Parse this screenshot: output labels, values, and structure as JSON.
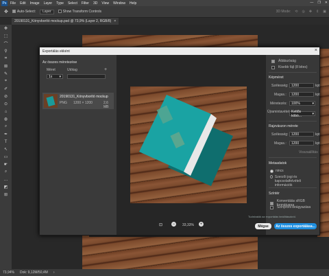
{
  "app": {
    "menu": [
      "File",
      "Edit",
      "Image",
      "Layer",
      "Type",
      "Select",
      "Filter",
      "3D",
      "View",
      "Window",
      "Help"
    ],
    "logo": "Ps",
    "window_controls": [
      "—",
      "❐",
      "✕"
    ]
  },
  "options_bar": {
    "auto_select_label": "Auto-Select:",
    "auto_select_value": "Layer",
    "transform_controls_label": "Show Transform Controls",
    "mode_3d": "3D Mode:"
  },
  "document": {
    "tab_title": "20190131_Könyvborító mockup.psd @ 73,9% (Layer 2, RGB/8)",
    "close": "×"
  },
  "tools": [
    "✥",
    "⬚",
    "⌒",
    "⚲",
    "⌗",
    "⊠",
    "✎",
    "⌖",
    "✐",
    "⊘",
    "⊙",
    "⌂",
    "◍",
    "⌕",
    "✒",
    "T",
    "↖",
    "▭",
    "☛",
    "⌕",
    "…",
    "◩",
    "⊞"
  ],
  "status": {
    "zoom": "73,94%",
    "doc_size": "Dok: 9,12M/50,4M"
  },
  "dialog": {
    "title": "Exportálás ekként",
    "close": "×",
    "left": {
      "section": "Az összes méretezése",
      "size_label": "Méret",
      "suffix_label": "Utótag",
      "add": "+",
      "scale": "1x",
      "item_name": "20190131_Könyvborító mockup",
      "item_format": "PNG",
      "item_dims": "1200 × 1200",
      "item_size": "2,6 MB"
    },
    "preview": {
      "zoom": "33,33%",
      "zoom_out": "−",
      "zoom_in": "+"
    },
    "right": {
      "transparency_label": "Átlátszóság",
      "transparency_checked": true,
      "smaller_file_label": "Kisebb fájl (8 bites)",
      "smaller_file_checked": false,
      "image_size_head": "Képméret",
      "width_label": "Szélesség:",
      "width_value": "1200",
      "height_label": "Magas.:",
      "height_value": "1200",
      "unit": "kpt",
      "scale_label": "Méretezés:",
      "scale_value": "100%",
      "resample_label": "Újramintavétel:",
      "resample_value": "Kettős köbö...",
      "canvas_head": "Rajzvászon mérete",
      "canvas_width_label": "Szélesség:",
      "canvas_width_value": "1200",
      "canvas_height_label": "Magas.:",
      "canvas_height_value": "1200",
      "restore": "Visszaállítás",
      "metadata_head": "Metaadatok",
      "meta_none": "nincs",
      "meta_copyright": "Szerzői jogi és kapcsolatfelvételi információk",
      "meta_selected": "none",
      "color_head": "Színtér",
      "convert_srgb": "Konvertálás sRGB formátumra",
      "convert_srgb_checked": true,
      "embed_profile": "Színprofil beágyazása",
      "embed_profile_checked": false,
      "learn_more": "Tudnivalók az exportálás beállításokról.",
      "cancel": "Mégse",
      "export_all": "Az összes exportálása..."
    }
  },
  "colors": {
    "accent": "#1f8fe0",
    "book": "#1a9a9a",
    "wood": "#7a4a2d"
  }
}
